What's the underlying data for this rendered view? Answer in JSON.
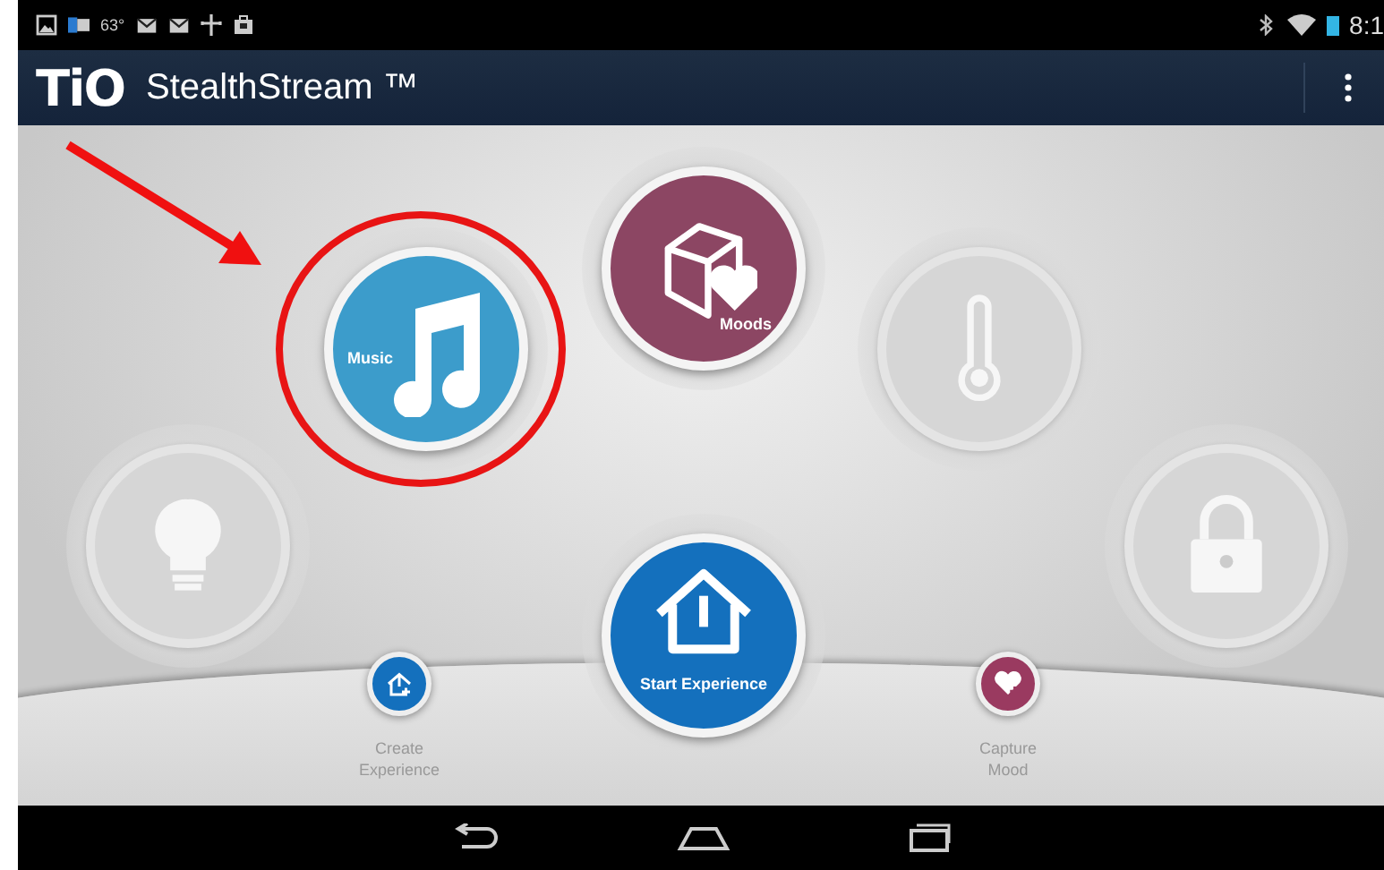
{
  "status_bar": {
    "temperature": "63°",
    "clock": "8:1"
  },
  "app_bar": {
    "logo": "TiO",
    "title": "StealthStream ™"
  },
  "tiles": [
    {
      "kind": "music",
      "label": "Music",
      "enabled": true,
      "highlighted": true
    },
    {
      "kind": "moods",
      "label": "Moods",
      "enabled": true,
      "highlighted": false
    },
    {
      "kind": "thermometer",
      "enabled": false,
      "highlighted": false
    },
    {
      "kind": "lightbulb",
      "enabled": false,
      "highlighted": false
    },
    {
      "kind": "lock",
      "enabled": false,
      "highlighted": false
    },
    {
      "kind": "start",
      "label": "Start Experience",
      "enabled": true,
      "highlighted": false
    }
  ],
  "actions": [
    {
      "kind": "create",
      "label": "Create Experience"
    },
    {
      "kind": "capture",
      "label": "Capture Mood"
    }
  ]
}
